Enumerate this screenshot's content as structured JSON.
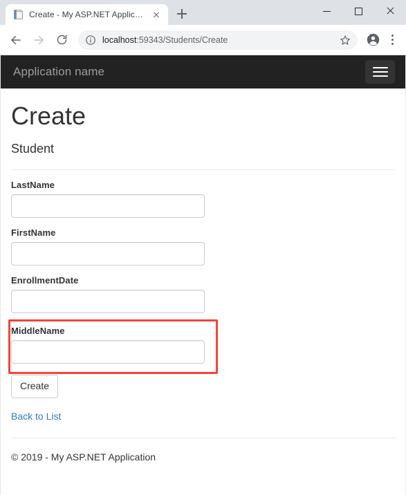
{
  "browser": {
    "tab": {
      "title": "Create - My ASP.NET Application",
      "favicon": "document-icon",
      "close_icon": "close-icon"
    },
    "new_tab_icon": "plus-icon",
    "window_controls": {
      "minimize": "minimize-icon",
      "maximize": "maximize-icon",
      "close": "close-icon"
    },
    "toolbar": {
      "back_icon": "arrow-left-icon",
      "forward_icon": "arrow-right-icon",
      "reload_icon": "reload-icon",
      "site_info_icon": "info-circle-icon",
      "url_host": "localhost",
      "url_rest": ":59343/Students/Create",
      "url_full": "localhost:59343/Students/Create",
      "bookmark_icon": "star-icon",
      "profile_icon": "account-avatar-icon",
      "menu_icon": "three-dot-menu-icon"
    }
  },
  "page": {
    "navbar": {
      "brand": "Application name",
      "toggle_icon": "hamburger-menu-icon"
    },
    "title": "Create",
    "subtitle": "Student",
    "fields": [
      {
        "label": "LastName",
        "value": "",
        "placeholder": ""
      },
      {
        "label": "FirstName",
        "value": "",
        "placeholder": ""
      },
      {
        "label": "EnrollmentDate",
        "value": "",
        "placeholder": ""
      },
      {
        "label": "MiddleName",
        "value": "",
        "placeholder": ""
      }
    ],
    "submit_label": "Create",
    "back_link": "Back to List",
    "footer": "© 2019 - My ASP.NET Application",
    "annotation": {
      "target_field": "MiddleName",
      "color": "#f9423a"
    }
  }
}
